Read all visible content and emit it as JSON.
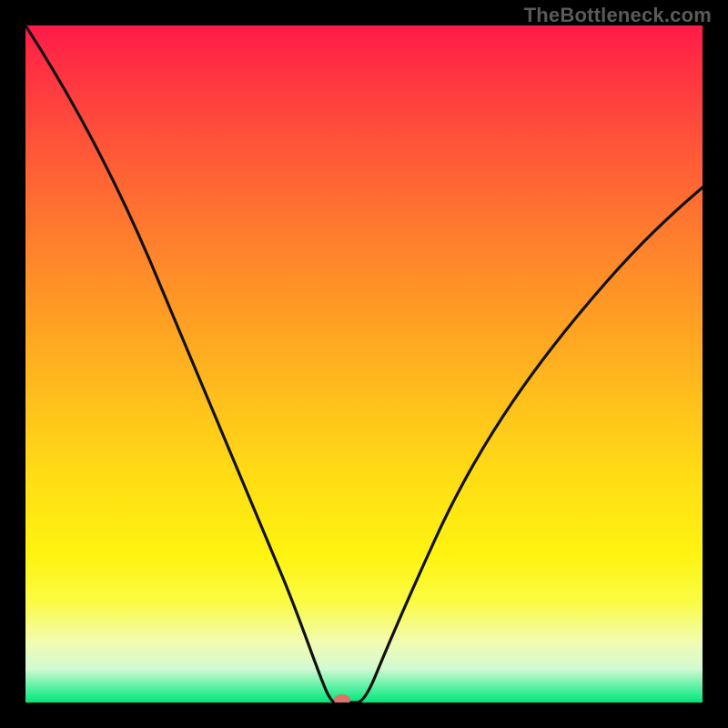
{
  "watermark": "TheBottleneck.com",
  "chart_data": {
    "type": "line",
    "title": "",
    "xlabel": "",
    "ylabel": "",
    "xlim": [
      0,
      1
    ],
    "ylim": [
      0,
      1
    ],
    "series": [
      {
        "name": "curve",
        "x": [
          0.0,
          0.08,
          0.16,
          0.24,
          0.3,
          0.36,
          0.4,
          0.43,
          0.448,
          0.455,
          0.458,
          0.47,
          0.49,
          0.51,
          0.54,
          0.58,
          0.64,
          0.72,
          0.82,
          0.92,
          1.0
        ],
        "values": [
          1.0,
          0.88,
          0.74,
          0.58,
          0.46,
          0.33,
          0.22,
          0.12,
          0.04,
          0.01,
          0.0,
          0.0,
          0.0,
          0.02,
          0.07,
          0.15,
          0.28,
          0.42,
          0.57,
          0.69,
          0.77
        ]
      }
    ],
    "annotations": [
      {
        "name": "minimum-marker",
        "x": 0.468,
        "y": 0.0
      }
    ],
    "background_gradient": {
      "type": "vertical",
      "stops": [
        {
          "pos": 0.0,
          "color": "#ff1a4a"
        },
        {
          "pos": 0.5,
          "color": "#ffc81a"
        },
        {
          "pos": 0.85,
          "color": "#fbfb42"
        },
        {
          "pos": 1.0,
          "color": "#00e676"
        }
      ]
    }
  }
}
